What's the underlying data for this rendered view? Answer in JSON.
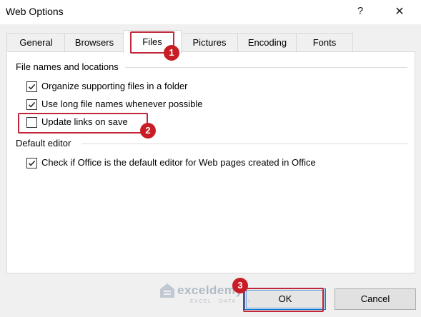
{
  "window": {
    "title": "Web Options",
    "help_glyph": "?",
    "close_glyph": "✕"
  },
  "tabs": [
    {
      "label": "General"
    },
    {
      "label": "Browsers"
    },
    {
      "label": "Files",
      "active": true
    },
    {
      "label": "Pictures"
    },
    {
      "label": "Encoding"
    },
    {
      "label": "Fonts"
    }
  ],
  "files_section": {
    "label": "File names and locations",
    "options": [
      {
        "label": "Organize supporting files in a folder",
        "checked": true
      },
      {
        "label": "Use long file names whenever possible",
        "checked": true
      },
      {
        "label": "Update links on save",
        "checked": false
      }
    ]
  },
  "editor_section": {
    "label": "Default editor",
    "options": [
      {
        "label": "Check if Office is the default editor for Web pages created in Office",
        "checked": true
      }
    ]
  },
  "markers": [
    "1",
    "2",
    "3"
  ],
  "buttons": {
    "ok_label": "OK",
    "cancel_label": "Cancel"
  },
  "watermark": {
    "name": "exceldemy",
    "tagline": "EXCEL · DATA · BI"
  },
  "colors": {
    "highlight": "#c0283a",
    "marker": "#c81d25",
    "ok_focus": "#0078d7"
  }
}
